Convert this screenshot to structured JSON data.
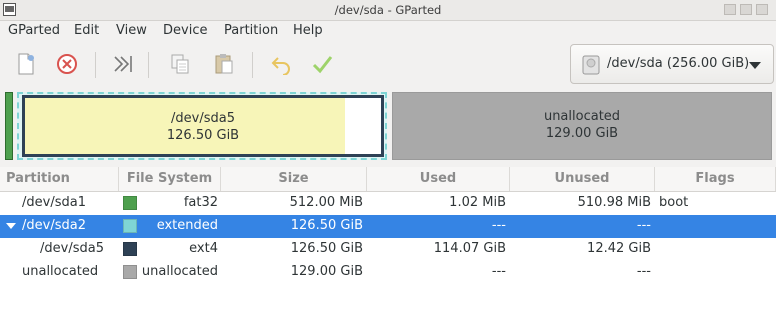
{
  "window": {
    "title": "/dev/sda - GParted"
  },
  "menu": {
    "items": [
      "GParted",
      "Edit",
      "View",
      "Device",
      "Partition",
      "Help"
    ]
  },
  "toolbar": {
    "buttons": [
      "new-icon",
      "delete-icon",
      "resize-move-icon",
      "copy-icon",
      "paste-icon",
      "undo-icon",
      "apply-icon"
    ]
  },
  "device_selector": {
    "label": "/dev/sda (256.00 GiB)"
  },
  "visual": {
    "sda5": {
      "name": "/dev/sda5",
      "size": "126.50 GiB",
      "used_fraction": 0.9
    },
    "unallocated": {
      "name": "unallocated",
      "size": "129.00 GiB"
    }
  },
  "table": {
    "headers": [
      "Partition",
      "File System",
      "Size",
      "Used",
      "Unused",
      "Flags"
    ],
    "rows": [
      {
        "partition": "/dev/sda1",
        "fs": "fat32",
        "fs_color": "#4ea04e",
        "size": "512.00 MiB",
        "used": "1.02 MiB",
        "unused": "510.98 MiB",
        "flags": "boot",
        "selected": false
      },
      {
        "partition": "/dev/sda2",
        "fs": "extended",
        "fs_color": "#7fd5d5",
        "size": "126.50 GiB",
        "used": "---",
        "unused": "---",
        "flags": "",
        "selected": true
      },
      {
        "partition": "/dev/sda5",
        "fs": "ext4",
        "fs_color": "#2e4155",
        "size": "126.50 GiB",
        "used": "114.07 GiB",
        "unused": "12.42 GiB",
        "flags": "",
        "selected": false
      },
      {
        "partition": "unallocated",
        "fs": "unallocated",
        "fs_color": "#a9a9a9",
        "size": "129.00 GiB",
        "used": "---",
        "unused": "---",
        "flags": "",
        "selected": false
      }
    ]
  }
}
